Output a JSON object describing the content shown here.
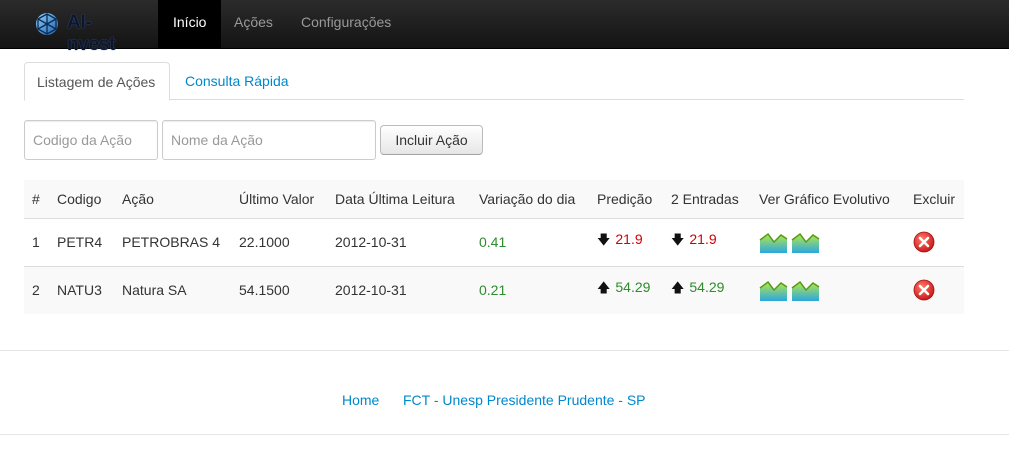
{
  "navbar": {
    "brand": "AI-nvest",
    "items": [
      {
        "label": "Início",
        "active": true
      },
      {
        "label": "Ações",
        "active": false
      },
      {
        "label": "Configurações",
        "active": false
      }
    ]
  },
  "tabs": [
    {
      "label": "Listagem de Ações",
      "active": true
    },
    {
      "label": "Consulta Rápida",
      "active": false
    }
  ],
  "form": {
    "codigo_placeholder": "Codigo da Ação",
    "nome_placeholder": "Nome da Ação",
    "incluir_label": "Incluir Ação"
  },
  "table": {
    "headers": [
      "#",
      "Codigo",
      "Ação",
      "Último Valor",
      "Data Última Leitura",
      "Variação do dia",
      "Predição",
      "2 Entradas",
      "Ver Gráfico Evolutivo",
      "Excluir"
    ],
    "rows": [
      {
        "num": "1",
        "codigo": "PETR4",
        "acao": "PETROBRAS 4",
        "ultimo_valor": "22.1000",
        "data": "2012-10-31",
        "variacao": "0.41",
        "predicao": "21.9",
        "predicao_dir": "down",
        "entradas": "21.9",
        "entradas_dir": "down"
      },
      {
        "num": "2",
        "codigo": "NATU3",
        "acao": "Natura SA",
        "ultimo_valor": "54.1500",
        "data": "2012-10-31",
        "variacao": "0.21",
        "predicao": "54.29",
        "predicao_dir": "up",
        "entradas": "54.29",
        "entradas_dir": "up"
      }
    ]
  },
  "icons": {
    "chart": "line-chart-icon",
    "delete": "delete-icon",
    "arrow_up": "arrow-up-icon",
    "arrow_down": "arrow-down-icon"
  },
  "footer": {
    "home": "Home",
    "fct": "FCT - Unesp Presidente Prudente - SP"
  },
  "colors": {
    "link": "#0088cc",
    "positive": "#2e8b2e",
    "negative": "#d40000",
    "navbar": "#1b1b1b"
  }
}
